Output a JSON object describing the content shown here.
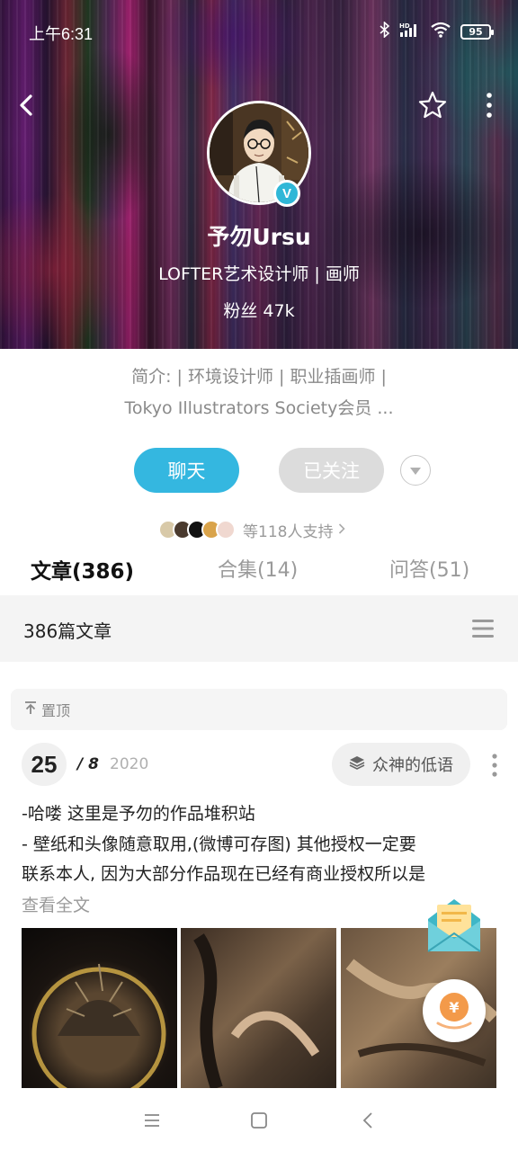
{
  "status_bar": {
    "time": "上午6:31",
    "battery": "95",
    "icons": [
      "bluetooth-icon",
      "hd-signal-icon",
      "wifi-icon",
      "battery-icon"
    ]
  },
  "profile": {
    "name": "予勿Ursu",
    "role": "LOFTER艺术设计师 | 画师",
    "fans": "粉丝 47k",
    "verified_mark": "V",
    "bio_line1": "简介: | 环境设计师 | 职业插画师 |",
    "bio_line2": "Tokyo Illustrators Society会员 ..."
  },
  "actions": {
    "chat": "聊天",
    "followed": "已关注"
  },
  "supporters": {
    "text": "等118人支持"
  },
  "tabs": [
    {
      "label": "文章(386)",
      "active": true
    },
    {
      "label": "合集(14)",
      "active": false
    },
    {
      "label": "问答(51)",
      "active": false
    }
  ],
  "list_header": {
    "count": "386篇文章"
  },
  "pinned": {
    "label": "置顶"
  },
  "post": {
    "day": "25",
    "month": "/ 8",
    "year": "2020",
    "collection": "众神的低语",
    "line1": "-哈喽 这里是予勿的作品堆积站",
    "line2": " - 壁纸和头像随意取用,(微博可存图) 其他授权一定要",
    "line3": "联系本人, 因为大部分作品现在已经有商业授权所以是",
    "read_more": "查看全文"
  },
  "colors": {
    "accent": "#34b7e0",
    "followed_bg": "#dcdcdc",
    "muted_text": "#9a9a9a"
  }
}
